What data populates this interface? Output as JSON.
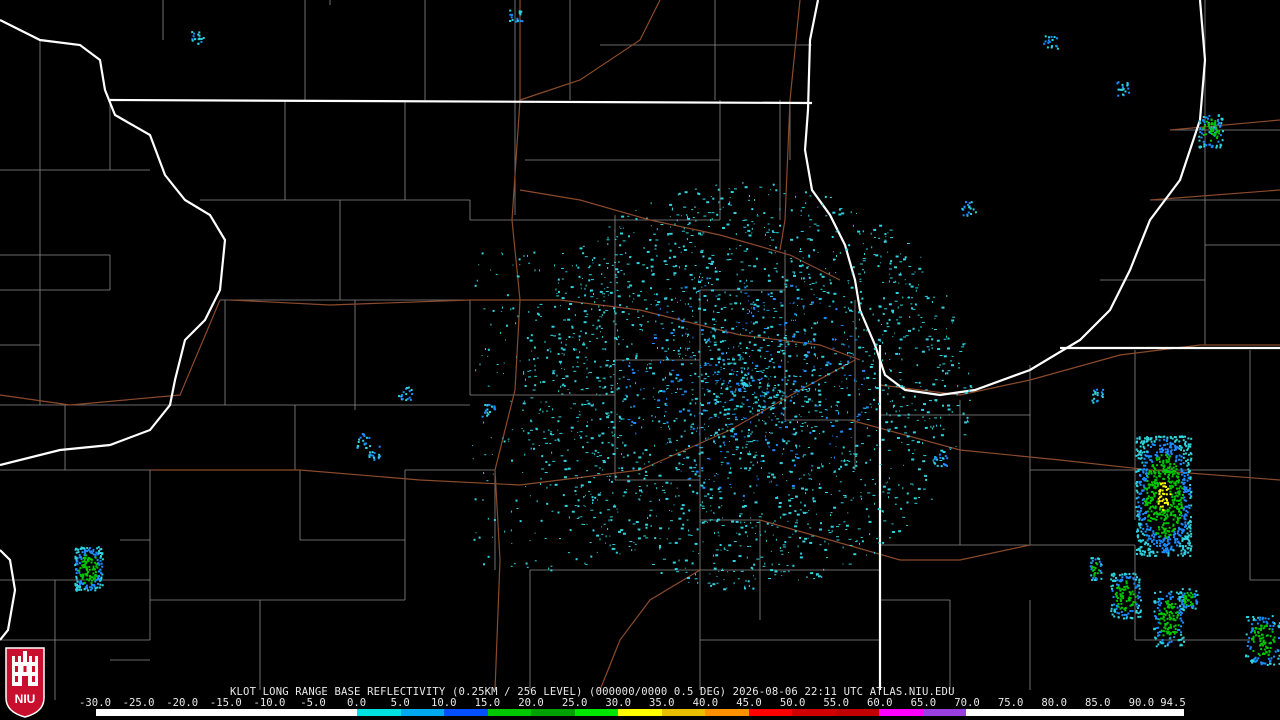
{
  "product": {
    "caption": "KLOT LONG RANGE BASE REFLECTIVITY (0.25KM / 256 LEVEL) (000000/0000 0.5 DEG) 2026-08-06 22:11 UTC  ATLAS.NIU.EDU"
  },
  "colorbar": {
    "ticks": [
      "-30.0",
      "-25.0",
      "-20.0",
      "-15.0",
      "-10.0",
      "-5.0",
      "0.0",
      "5.0",
      "10.0",
      "15.0",
      "20.0",
      "25.0",
      "30.0",
      "35.0",
      "40.0",
      "45.0",
      "50.0",
      "55.0",
      "60.0",
      "65.0",
      "70.0",
      "75.0",
      "80.0",
      "85.0",
      "90.0",
      "94.5"
    ],
    "colors": [
      "#ffffff",
      "#ffffff",
      "#ffffff",
      "#ffffff",
      "#ffffff",
      "#ffffff",
      "#00e0e0",
      "#00a8f0",
      "#0050ff",
      "#00c800",
      "#00a000",
      "#00e600",
      "#ffff00",
      "#e8c000",
      "#ff9000",
      "#ff0000",
      "#d00000",
      "#c00000",
      "#ff00ff",
      "#9a40e0",
      "#ffffff",
      "#ffffff",
      "#ffffff",
      "#ffffff",
      "#ffffff"
    ]
  },
  "logo": {
    "text": "NIU",
    "colors": {
      "badge": "#c8102e",
      "text": "#ffffff"
    }
  },
  "map_colors": {
    "background": "#000000",
    "state_borders": "#ffffff",
    "county_lines": "#b4b4b4",
    "roads": "#8b4a2b",
    "echo_light": "#2fd4e0",
    "echo_medium": "#1c8cff",
    "echo_strong": "#00c800",
    "echo_core": "#ffff00"
  }
}
